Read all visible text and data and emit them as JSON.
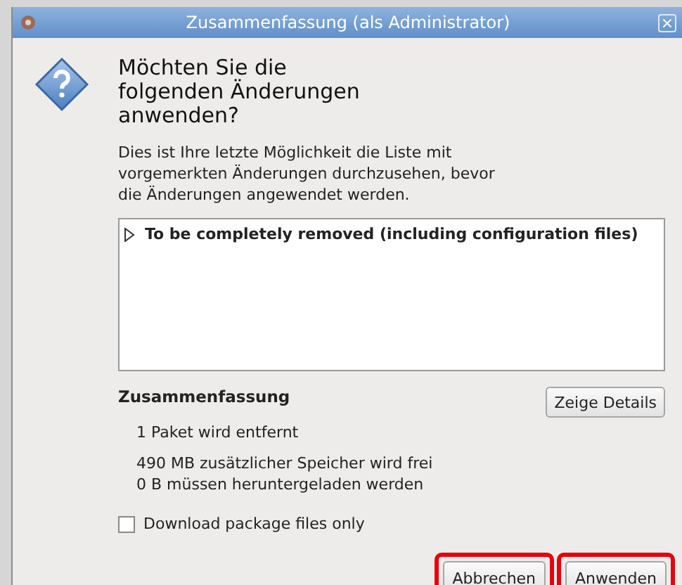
{
  "window": {
    "title": "Zusammenfassung (als Administrator)",
    "close": "×"
  },
  "heading": "Möchten Sie die folgenden Änderungen anwenden?",
  "description": "Dies ist Ihre letzte Möglichkeit die Liste mit vorgemerkten Änderungen durchzusehen, bevor die Änderungen angewendet werden.",
  "changes": [
    {
      "label": "To be completely removed (including configuration files)",
      "expanded": false
    }
  ],
  "summary": {
    "title": "Zusammenfassung",
    "lines": [
      "1 Paket wird entfernt",
      "490 MB zusätzlicher Speicher wird frei",
      "0  B müssen heruntergeladen werden"
    ],
    "details_button": "Zeige Details"
  },
  "download_only": {
    "label": "Download package files only",
    "checked": false
  },
  "buttons": [
    {
      "label": "Abbrechen",
      "highlighted": true
    },
    {
      "label": "Anwenden",
      "highlighted": true
    }
  ]
}
